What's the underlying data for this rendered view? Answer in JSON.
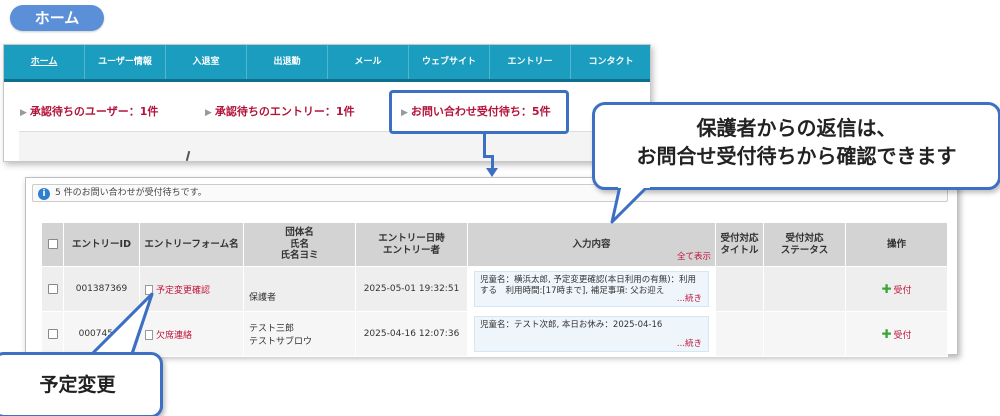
{
  "title_pill": "ホーム",
  "nav": [
    "ホーム",
    "ユーザー情報",
    "入退室",
    "出退勤",
    "メール",
    "ウェブサイト",
    "エントリー",
    "コンタクト"
  ],
  "pending": {
    "users": "承認待ちのユーザー：1件",
    "entries": "承認待ちのエントリー：1件",
    "inquiries": "お問い合わせ受付待ち：5件"
  },
  "info_bar": "5 件のお問い合わせが受付待ちです。",
  "table": {
    "headers": {
      "entry_id": "エントリーID",
      "entry_form": "エントリーフォーム名",
      "group_line1": "団体名",
      "group_line2": "氏名",
      "group_line3": "氏名ヨミ",
      "datetime_line1": "エントリー日時",
      "datetime_line2": "エントリー者",
      "content": "入力内容",
      "show_all": "全て表示",
      "title_line1": "受付対応",
      "title_line2": "タイトル",
      "status_line1": "受付対応",
      "status_line2": "ステータス",
      "action": "操作"
    },
    "rows": [
      {
        "id": "001387369",
        "form": "予定変更確認",
        "group_line1": "保護者",
        "group_line2": "",
        "datetime": "2025-05-01 19:32:51",
        "content": "児童名：横浜太郎, 予定変更確認(本日利用の有無)：利用する　利用時間:[17時まで], 補足事項: 父お迎え",
        "more": "...続き",
        "action": "受付"
      },
      {
        "id": "00074516",
        "form": "欠席連絡",
        "group_line1": "テスト三郎",
        "group_line2": "テストサブロウ",
        "datetime": "2025-04-16 12:07:36",
        "content": "児童名：テスト次郎, 本日お休み：2025-04-16",
        "more": "...続き",
        "action": "受付"
      }
    ]
  },
  "callout_right": {
    "line1": "保護者からの返信は、",
    "line2": "お問合せ受付待ちから確認できます"
  },
  "callout_left": "予定変更",
  "colors": {
    "accent_blue": "#3d6fc2",
    "nav_teal": "#1a9dbf",
    "link_red": "#c0143c",
    "pill_blue": "#5b8fd8"
  }
}
